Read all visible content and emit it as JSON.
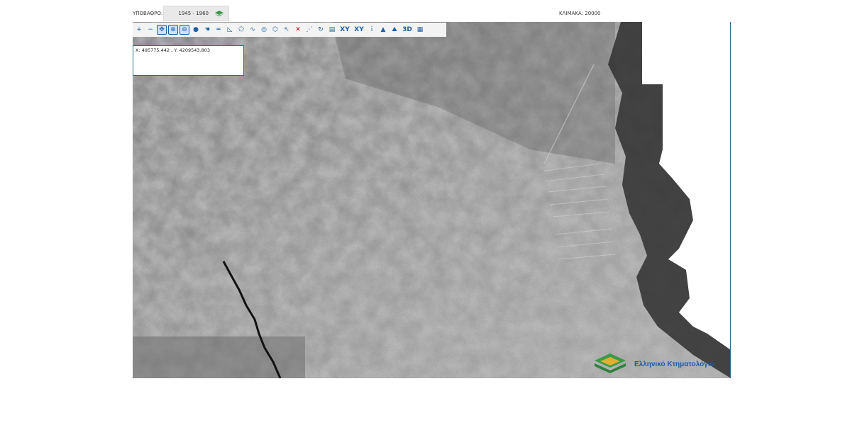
{
  "header": {
    "basemap_label": "ΥΠΟΒΑΘΡΟ:",
    "basemap_value": "1945 - 1960",
    "scale_label": "ΚΛΙΜΑΚΑ: 20000"
  },
  "toolbar": {
    "tools": [
      {
        "icon": "zoom-in-icon",
        "glyph": "+"
      },
      {
        "icon": "zoom-out-icon",
        "glyph": "−"
      },
      {
        "icon": "pan-icon",
        "glyph": "✥",
        "selected": true
      },
      {
        "icon": "zoom-box-in-icon",
        "glyph": "⊕",
        "selected": true
      },
      {
        "icon": "zoom-box-out-icon",
        "glyph": "⊖",
        "selected": true
      },
      {
        "icon": "user-icon",
        "glyph": "●"
      },
      {
        "icon": "pointer-hand-icon",
        "glyph": "☚"
      },
      {
        "icon": "measure-line-icon",
        "glyph": "═"
      },
      {
        "icon": "measure-angle-icon",
        "glyph": "◺"
      },
      {
        "icon": "measure-area-icon",
        "glyph": "⬠"
      },
      {
        "icon": "draw-line-icon",
        "glyph": "∿"
      },
      {
        "icon": "target-icon",
        "glyph": "◎"
      },
      {
        "icon": "polygon-select-icon",
        "glyph": "⬡"
      },
      {
        "icon": "select-arrow-icon",
        "glyph": "↖"
      },
      {
        "icon": "clear-icon",
        "glyph": "✕",
        "color": "#c00000"
      },
      {
        "icon": "draw-points-icon",
        "glyph": "⋰"
      },
      {
        "icon": "refresh-icon",
        "glyph": "↻"
      },
      {
        "icon": "document-icon",
        "glyph": "▤"
      },
      {
        "icon": "xy-goto-icon",
        "glyph": "XY"
      },
      {
        "icon": "xy-locate-icon",
        "glyph": "XY"
      },
      {
        "icon": "info-icon",
        "glyph": "i"
      },
      {
        "icon": "profile-icon",
        "glyph": "▲"
      },
      {
        "icon": "terrain-icon",
        "glyph": "⛰"
      },
      {
        "icon": "3d-view-icon",
        "glyph": "3D"
      },
      {
        "icon": "layers-panel-icon",
        "glyph": "▦"
      }
    ]
  },
  "coordinates": {
    "text": "X: 495775.442 , Y: 4209543.803"
  },
  "logo": {
    "text": "Ελληνικό Κτηματολόγιο"
  },
  "colors": {
    "accent": "#1b5fa8",
    "border": "#2c6e7f",
    "logo_green": "#3a9a4a",
    "logo_yellow": "#e0b030"
  }
}
